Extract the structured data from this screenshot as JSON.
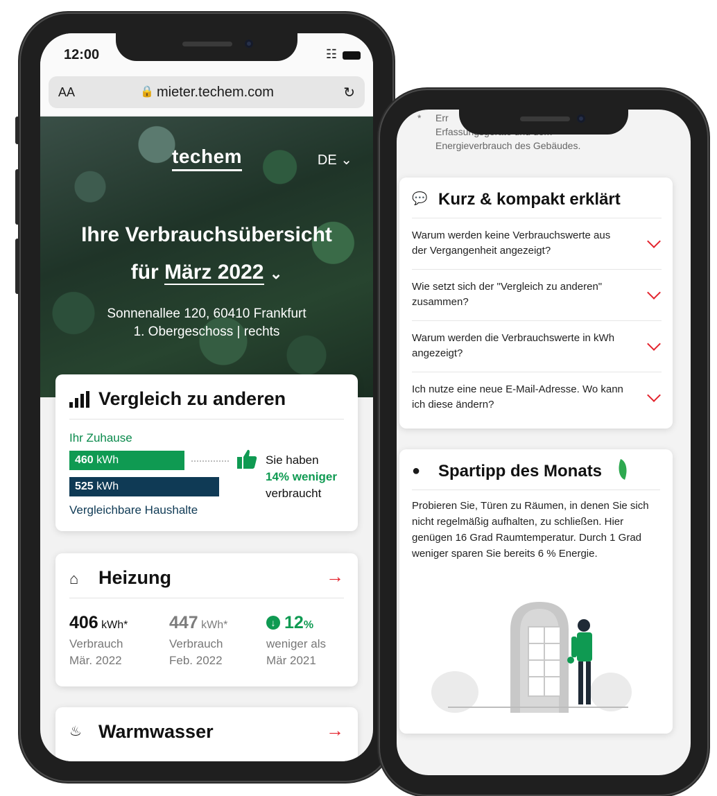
{
  "left": {
    "status": {
      "time": "12:00"
    },
    "browser": {
      "text_size": "AA",
      "url": "mieter.techem.com"
    },
    "hero": {
      "logo": "techem",
      "language": "DE",
      "title": "Ihre Verbrauchsübersicht",
      "period_prefix": "für",
      "period": "März 2022",
      "address_line1": "Sonnenallee 120, 60410 Frankfurt",
      "address_line2": "1. Obergeschoss | rechts"
    },
    "compare": {
      "title": "Vergleich zu anderen",
      "home_label": "Ihr Zuhause",
      "home_value": "460",
      "unit": "kWh",
      "others_value": "525",
      "others_label": "Vergleichbare Haushalte",
      "summary_1": "Sie haben",
      "summary_2": "14% weniger",
      "summary_3": "verbraucht"
    },
    "heating": {
      "title": "Heizung",
      "metrics": [
        {
          "value": "406",
          "unit": "kWh*",
          "line1": "Verbrauch",
          "line2": "Mär. 2022"
        },
        {
          "value": "447",
          "unit": "kWh*",
          "line1": "Verbrauch",
          "line2": "Feb. 2022"
        },
        {
          "value": "12",
          "unit": "%",
          "line1": "weniger als",
          "line2": "Mär 2021"
        }
      ]
    },
    "water": {
      "title": "Warmwasser"
    }
  },
  "right": {
    "footnote": {
      "marker": "*",
      "line1": "Err",
      "line2": "Erfassungsgeräte und dem",
      "line3": "Energieverbrauch des Gebäudes."
    },
    "faq": {
      "title": "Kurz & kompakt erklärt",
      "items": [
        "Warum werden keine Verbrauchswerte aus der Vergangenheit angezeigt?",
        "Wie setzt sich der \"Vergleich zu anderen\" zusammen?",
        "Warum werden die Verbrauchswerte in kWh angezeigt?",
        "Ich nutze eine neue E-Mail-Adresse. Wo kann ich diese ändern?"
      ]
    },
    "tip": {
      "title": "Spartipp des Monats",
      "body": "Probieren Sie, Türen zu Räumen, in denen Sie sich nicht regelmäßig aufhalten, zu schließen. Hier genügen 16 Grad Raumtemperatur. Durch 1 Grad weniger sparen Sie bereits 6 % Energie."
    }
  },
  "colors": {
    "accent_red": "#e3222c",
    "green": "#0f9a52",
    "navy": "#0f3a55"
  }
}
